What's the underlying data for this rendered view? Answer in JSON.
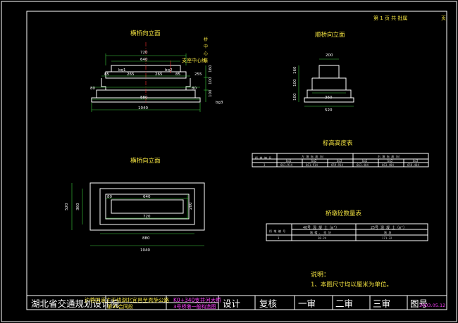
{
  "header": {
    "page": "第 1 页  共  批属",
    "page_suffix": "页"
  },
  "view1": {
    "title": "横桥向立面",
    "center_line": "支座中心线",
    "vert_label": [
      "桥",
      "中",
      "心",
      "线"
    ],
    "dims": {
      "d720": "720",
      "d640": "640",
      "d85": "85",
      "d265": "265",
      "d265b": "265",
      "d85b": "85",
      "d80": "80",
      "d80b": "80",
      "d880": "880",
      "d1040": "1040",
      "v160": "160",
      "v100": "100",
      "v100b": "100"
    },
    "bg1": "bg1",
    "bg2": "bg2",
    "bg3": "bg3"
  },
  "view2": {
    "title": "顺桥向立面",
    "dims": {
      "d200": "200",
      "d360": "360",
      "d520": "520",
      "v160": "160",
      "v100": "100",
      "v100b": "100"
    }
  },
  "view3": {
    "title": "横桥向立面",
    "dims": {
      "d80": "80",
      "d640": "640",
      "d720": "720",
      "d880": "880",
      "d1040": "1040",
      "v520": "520",
      "v360": "360",
      "v200": "200"
    }
  },
  "table1": {
    "title": "标高高度表",
    "head1": [
      "桥 墩 编 号",
      "左 墩 标 高（m）",
      "右 墩 标 高（m）"
    ],
    "head2": [
      "bg1",
      "bg2",
      "bg3",
      "bg1",
      "bg2",
      "bg3"
    ],
    "row": [
      "3",
      "661.914",
      "661.914",
      "659.914",
      "663.404",
      "663.404",
      "658.404"
    ]
  },
  "table2": {
    "title": "桥墩砼数量表",
    "head1": [
      "桥 墩 编 号",
      "40号 混 凝 土（m³）",
      "25号 混 凝 土（m³）"
    ],
    "head2": [
      "墩 帽 、 挡 块",
      "墩 身"
    ],
    "row": [
      "3",
      "30.24",
      "171.32"
    ]
  },
  "note": {
    "title": "说明：",
    "line1": "1、本图尺寸均以厘米为单位。"
  },
  "titleblock": {
    "company": "湖北省交通规划设计院",
    "project1": "沪蓉国道主干线湖北宜昌至恩施公路",
    "project2": "第30合同段",
    "drawing1": "K0+340支井河大桥",
    "drawing2": "3号桥墩一般构造图",
    "design": "设计",
    "review": "复核",
    "audit1": "一审",
    "audit2": "二审",
    "audit3": "三审",
    "drawing_no": "图号",
    "date": "2003.05.12"
  }
}
